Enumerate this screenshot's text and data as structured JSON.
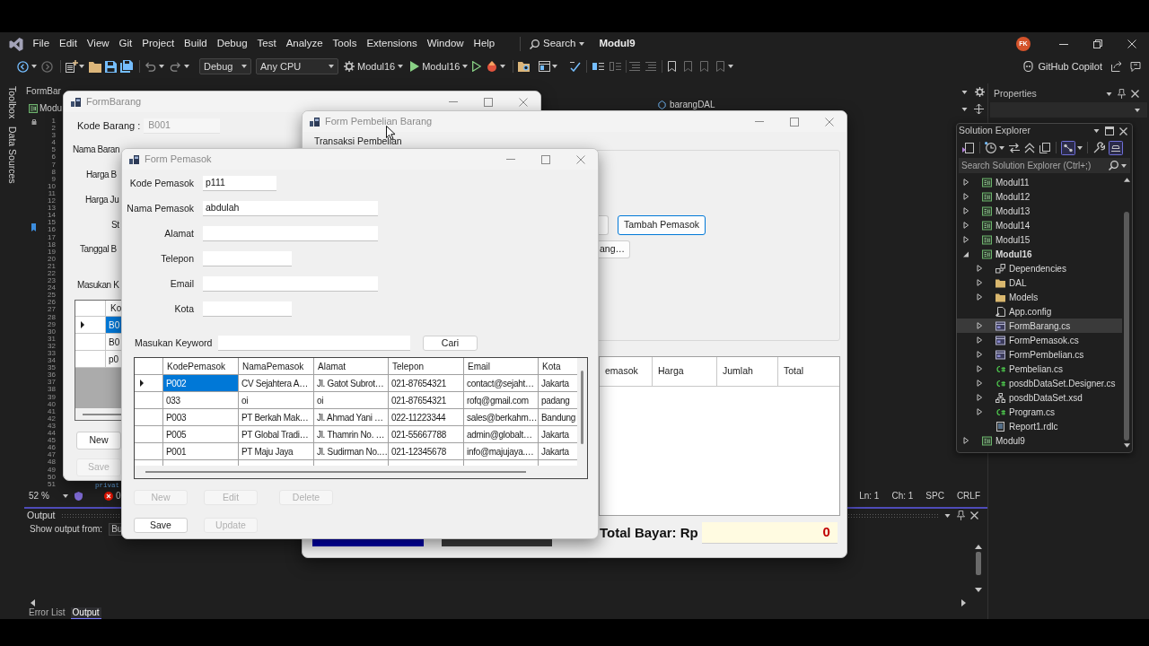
{
  "menu_bar": {
    "items": [
      "File",
      "Edit",
      "View",
      "Git",
      "Project",
      "Build",
      "Debug",
      "Test",
      "Analyze",
      "Tools",
      "Extensions",
      "Window",
      "Help"
    ],
    "search": "Search",
    "solution_name": "Modul9",
    "avatar": "FK"
  },
  "toolbar": {
    "configuration": "Debug",
    "platform": "Any CPU",
    "startup_project": "Modul16",
    "run_target": "Modul16",
    "copilot": "GitHub Copilot"
  },
  "side_tabs": [
    "Toolbox",
    "Data Sources"
  ],
  "editor": {
    "tab": "FormBar",
    "navigation": "Modu",
    "type_dropdown": "barangDAL",
    "line_numbers": [
      "1",
      "2",
      "3",
      "4",
      "5",
      "6",
      "7",
      "8",
      "9",
      "10",
      "11",
      "12",
      "13",
      "14",
      "15",
      "16",
      "17",
      "18",
      "19",
      "20",
      "21",
      "22",
      "23",
      "24",
      "25",
      "26",
      "27",
      "28",
      "29",
      "30",
      "31",
      "32",
      "33",
      "34",
      "35",
      "36",
      "37",
      "38",
      "39",
      "40",
      "41",
      "42",
      "43",
      "44",
      "45",
      "46",
      "47",
      "48",
      "49",
      "50",
      "51"
    ],
    "code_fragment": "privat",
    "zoom": "52 %",
    "error_count": "0",
    "status_items": [
      "Ln: 1",
      "Ch: 1",
      "SPC",
      "CRLF"
    ]
  },
  "output": {
    "title": "Output",
    "source_label": "Show output from:",
    "source_value": "Bu",
    "tabs": [
      {
        "label": "Error List",
        "selected": false
      },
      {
        "label": "Output",
        "selected": true
      }
    ]
  },
  "properties": {
    "title": "Properties"
  },
  "solution_explorer": {
    "title": "Solution Explorer",
    "search": {
      "placeholder": "Search Solution Explorer (Ctrl+;)"
    },
    "tree": [
      {
        "label": "Modul11",
        "kind": "project",
        "expanded": false,
        "bold": false,
        "selected": false
      },
      {
        "label": "Modul12",
        "kind": "project",
        "expanded": false,
        "bold": false,
        "selected": false
      },
      {
        "label": "Modul13",
        "kind": "project",
        "expanded": false,
        "bold": false,
        "selected": false
      },
      {
        "label": "Modul14",
        "kind": "project",
        "expanded": false,
        "bold": false,
        "selected": false
      },
      {
        "label": "Modul15",
        "kind": "project",
        "expanded": false,
        "bold": false,
        "selected": false
      },
      {
        "label": "Modul16",
        "kind": "project",
        "expanded": true,
        "bold": true,
        "selected": false,
        "children": [
          {
            "label": "Dependencies",
            "kind": "dependencies",
            "expanded": false,
            "selected": false
          },
          {
            "label": "DAL",
            "kind": "folder",
            "expanded": false,
            "selected": false
          },
          {
            "label": "Models",
            "kind": "folder",
            "expanded": false,
            "selected": false
          },
          {
            "label": "App.config",
            "kind": "config",
            "selected": false
          },
          {
            "label": "FormBarang.cs",
            "kind": "form",
            "expanded": false,
            "selected": true
          },
          {
            "label": "FormPemasok.cs",
            "kind": "form",
            "expanded": false,
            "selected": false
          },
          {
            "label": "FormPembelian.cs",
            "kind": "form",
            "expanded": false,
            "selected": false
          },
          {
            "label": "Pembelian.cs",
            "kind": "csharp",
            "expanded": false,
            "selected": false
          },
          {
            "label": "posdbDataSet.Designer.cs",
            "kind": "csharp",
            "expanded": false,
            "selected": false
          },
          {
            "label": "posdbDataSet.xsd",
            "kind": "dataset",
            "expanded": false,
            "selected": false
          },
          {
            "label": "Program.cs",
            "kind": "csharp",
            "expanded": false,
            "selected": false
          },
          {
            "label": "Report1.rdlc",
            "kind": "report",
            "selected": false
          }
        ]
      },
      {
        "label": "Modul9",
        "kind": "project",
        "expanded": false,
        "bold": false,
        "selected": false
      }
    ]
  },
  "form_barang": {
    "title": "FormBarang",
    "fields": [
      {
        "label": "Kode Barang :",
        "value": "B001",
        "disabled": true
      }
    ],
    "labels": [
      "Nama Baran",
      "Harga B",
      "Harga Ju",
      "St",
      "Tanggal B",
      "Masukan K"
    ],
    "grid": {
      "columns": [
        "Ko"
      ],
      "rows": [
        {
          "cells": [
            "B0"
          ],
          "selected": true
        },
        {
          "cells": [
            "B0"
          ],
          "selected": false
        },
        {
          "cells": [
            "p0"
          ],
          "selected": false
        }
      ]
    },
    "buttons": [
      {
        "label": "New",
        "disabled": false
      },
      {
        "label": "Save",
        "disabled": true
      }
    ]
  },
  "form_pembelian": {
    "title": "Form Pembelian Barang",
    "group_title": "Transaksi Pembelian",
    "buttons": [
      {
        "label": "Tambah Pemasok",
        "focused": true
      },
      {
        "label": "ang…",
        "focused": false
      }
    ],
    "grid": {
      "columns": [
        "emasok",
        "Harga",
        "Jumlah",
        "Total"
      ]
    },
    "total_label": "Total Bayar: Rp",
    "total_value": "0"
  },
  "form_pemasok": {
    "title": "Form Pemasok",
    "fields": [
      {
        "label": "Kode Pemasok",
        "value": "p111"
      },
      {
        "label": "Nama Pemasok",
        "value": "abdulah"
      },
      {
        "label": "Alamat"
      },
      {
        "label": "Telepon"
      },
      {
        "label": "Email"
      },
      {
        "label": "Kota"
      }
    ],
    "search": {
      "label": "Masukan Keyword",
      "button": "Cari"
    },
    "grid": {
      "columns": [
        "KodePemasok",
        "NamaPemasok",
        "Alamat",
        "Telepon",
        "Email",
        "Kota"
      ],
      "rows": [
        {
          "cells": [
            "P002",
            "CV Sejahtera A…",
            "Jl. Gatot Subrot…",
            "021-87654321",
            "contact@sejaht…",
            "Jakarta"
          ],
          "selected": true
        },
        {
          "cells": [
            "033",
            "oi",
            "oi",
            "021-87654321",
            "rofq@gmail.com",
            "padang"
          ],
          "selected": false
        },
        {
          "cells": [
            "P003",
            "PT Berkah Mak…",
            "Jl. Ahmad Yani …",
            "022-11223344",
            "sales@berkahm…",
            "Bandung"
          ],
          "selected": false
        },
        {
          "cells": [
            "P005",
            "PT Global Tradi…",
            "Jl. Thamrin No. …",
            "021-55667788",
            "admin@globalt…",
            "Jakarta"
          ],
          "selected": false
        },
        {
          "cells": [
            "P001",
            "PT Maju Jaya",
            "Jl. Sudirman No.…",
            "021-12345678",
            "info@majujaya.…",
            "Jakarta"
          ],
          "selected": false
        }
      ]
    },
    "button_rows": [
      [
        {
          "label": "New",
          "disabled": true
        },
        {
          "label": "Edit",
          "disabled": true
        },
        {
          "label": "Delete",
          "disabled": true
        }
      ],
      [
        {
          "label": "Save",
          "disabled": false
        },
        {
          "label": "Update",
          "disabled": true
        }
      ]
    ]
  }
}
